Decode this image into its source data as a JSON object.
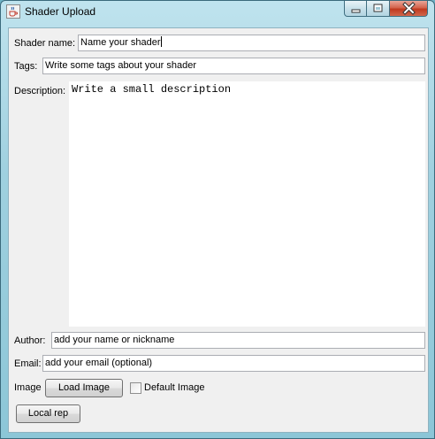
{
  "window": {
    "title": "Shader Upload",
    "icon": "java-cup-icon",
    "controls": {
      "minimize": "minimize-icon",
      "maximize": "maximize-icon",
      "close": "close-icon"
    }
  },
  "form": {
    "shader_name": {
      "label": "Shader name:",
      "value": "Name your shader"
    },
    "tags": {
      "label": "Tags:",
      "value": "Write some tags about your shader"
    },
    "description": {
      "label": "Description:",
      "value": "Write a small description"
    },
    "author": {
      "label": "Author:",
      "value": "add your name or nickname"
    },
    "email": {
      "label": "Email:",
      "value": "add your email (optional)"
    },
    "image": {
      "label": "Image",
      "load_button": "Load Image",
      "default_checkbox_label": "Default Image",
      "default_checked": false
    },
    "local_rep_button": "Local rep"
  },
  "colors": {
    "frame_accent": "#9fd0df",
    "close_button": "#c0391f",
    "panel_background": "#f0f0f0"
  }
}
